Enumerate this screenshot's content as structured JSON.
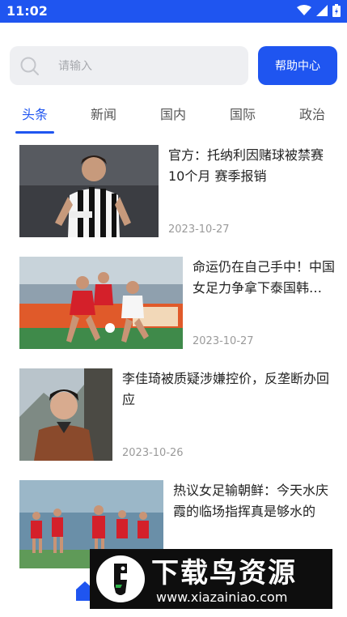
{
  "status_bar": {
    "time": "11:02",
    "icons": [
      "wifi-icon",
      "signal-icon",
      "battery-icon"
    ]
  },
  "search": {
    "placeholder": "请输入"
  },
  "help_button": {
    "label": "帮助中心"
  },
  "tabs": [
    {
      "label": "头条",
      "active": true
    },
    {
      "label": "新闻",
      "active": false
    },
    {
      "label": "国内",
      "active": false
    },
    {
      "label": "国际",
      "active": false
    },
    {
      "label": "政治",
      "active": false
    }
  ],
  "articles": [
    {
      "title": "官方：托纳利因赌球被禁赛10个月 赛季报销",
      "date": "2023-10-27"
    },
    {
      "title": "命运仍在自己手中！中国女足力争拿下泰国韩国锁定出线",
      "date": "2023-10-27"
    },
    {
      "title": "李佳琦被质疑涉嫌控价，反垄断办回应",
      "date": "2023-10-26"
    },
    {
      "title": "热议女足输朝鲜：今天水庆霞的临场指挥真是够水的",
      "date": ""
    }
  ],
  "watermark": {
    "title": "下载鸟资源",
    "url": "www.xiazainiao.com"
  },
  "colors": {
    "accent": "#1f55f0",
    "date": "#9a9a9a",
    "search_bg": "#eeeff2"
  }
}
